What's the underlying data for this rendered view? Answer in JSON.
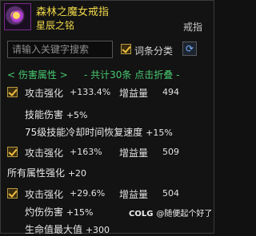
{
  "item": {
    "name": "森林之魔女戒指",
    "subtitle": "星辰之铭",
    "type": "戒指",
    "icon": "ring-icon"
  },
  "search": {
    "placeholder": "请输入关键字搜索",
    "category_label": "词条分类",
    "category_checked": true,
    "refresh_icon": "refresh-icon"
  },
  "group": {
    "left": "< 伤害属性 >",
    "right": "共计30条 点击折叠",
    "color": "#48c870"
  },
  "entries": [
    {
      "checked": true,
      "attr": "攻击强化",
      "value": "+133.4%",
      "gain_label": "增益量",
      "gain": "494",
      "subs": [
        {
          "label": "技能伤害",
          "value": "+5%"
        },
        {
          "label": "75级技能冷却时间恢复速度",
          "value": "+15%"
        }
      ]
    },
    {
      "checked": true,
      "attr": "攻击强化",
      "value": "+163%",
      "gain_label": "增益量",
      "gain": "509",
      "subs": [
        {
          "label": "所有属性强化",
          "value": "+20"
        }
      ]
    },
    {
      "checked": true,
      "attr": "攻击强化",
      "value": "+29.6%",
      "gain_label": "增益量",
      "gain": "504",
      "subs": [
        {
          "label": "灼伤伤害",
          "value": "+15%"
        },
        {
          "label": "生命值最大值",
          "value": "+300"
        }
      ]
    }
  ],
  "footer_tag": {
    "brand": "COLG",
    "text": "@随便起个好了"
  },
  "colors": {
    "title": "#f0d848",
    "accent_green": "#48c870",
    "background": "#131313"
  }
}
